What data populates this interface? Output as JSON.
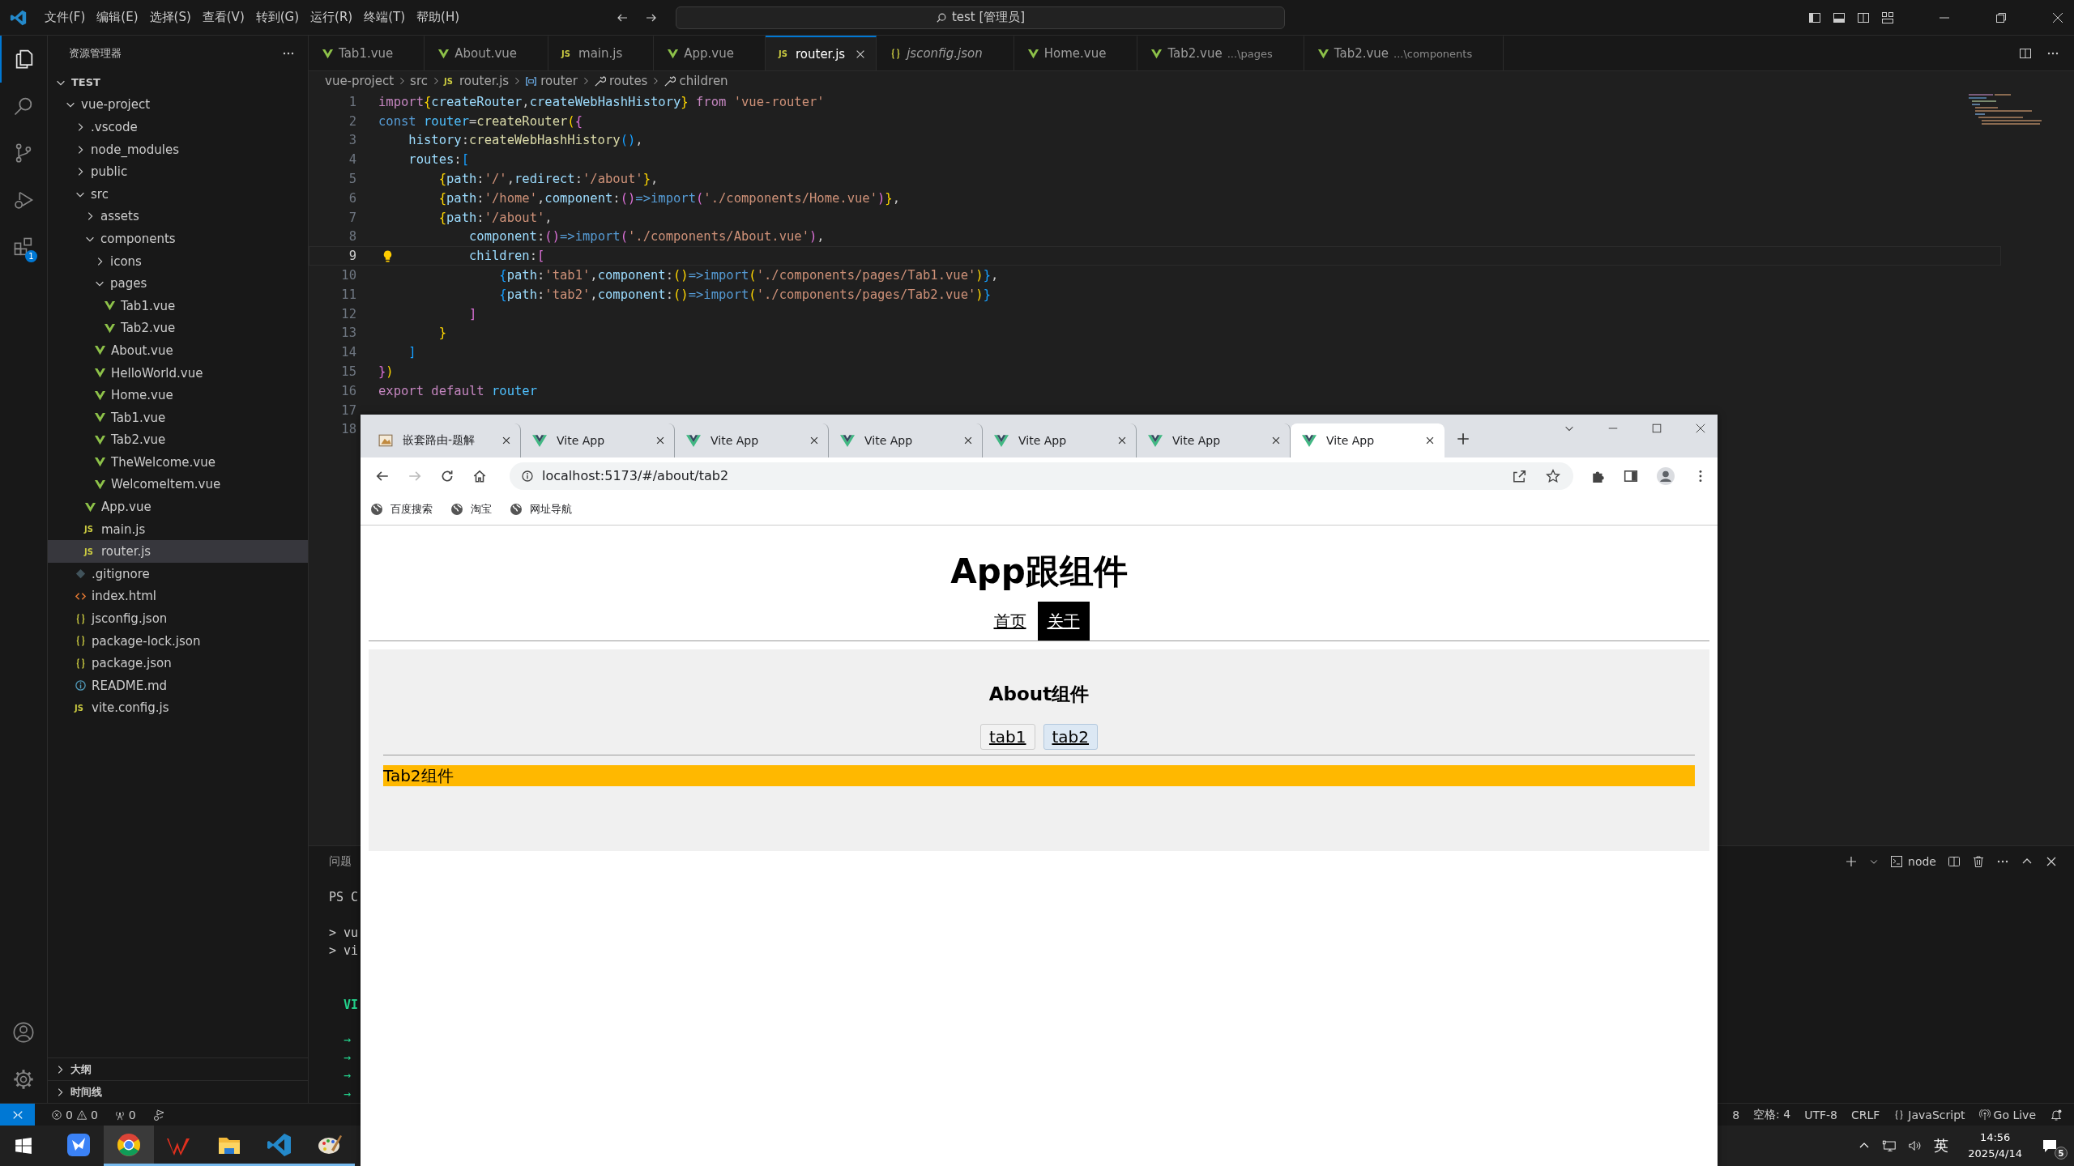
{
  "titlebar": {
    "menus": [
      "文件(F)",
      "编辑(E)",
      "选择(S)",
      "查看(V)",
      "转到(G)",
      "运行(R)",
      "终端(T)",
      "帮助(H)"
    ],
    "search": "test [管理员]"
  },
  "activity_bar": {
    "extensions_badge": "1"
  },
  "explorer": {
    "title": "资源管理器",
    "tree": [
      {
        "label": "TEST",
        "kind": "root",
        "expanded": true,
        "selected": false,
        "children": [
          {
            "label": "vue-project",
            "kind": "folder",
            "expanded": true,
            "selected": false,
            "children": [
              {
                "label": ".vscode",
                "kind": "folder",
                "expanded": false,
                "selected": false
              },
              {
                "label": "node_modules",
                "kind": "folder",
                "expanded": false,
                "selected": false
              },
              {
                "label": "public",
                "kind": "folder",
                "expanded": false,
                "selected": false
              },
              {
                "label": "src",
                "kind": "folder",
                "expanded": true,
                "selected": false,
                "children": [
                  {
                    "label": "assets",
                    "kind": "folder",
                    "expanded": false,
                    "selected": false
                  },
                  {
                    "label": "components",
                    "kind": "folder",
                    "expanded": true,
                    "selected": false,
                    "children": [
                      {
                        "label": "icons",
                        "kind": "folder",
                        "expanded": false,
                        "selected": false
                      },
                      {
                        "label": "pages",
                        "kind": "folder",
                        "expanded": true,
                        "selected": false,
                        "children": [
                          {
                            "label": "Tab1.vue",
                            "kind": "vue",
                            "selected": false
                          },
                          {
                            "label": "Tab2.vue",
                            "kind": "vue",
                            "selected": false
                          }
                        ]
                      },
                      {
                        "label": "About.vue",
                        "kind": "vue",
                        "selected": false
                      },
                      {
                        "label": "HelloWorld.vue",
                        "kind": "vue",
                        "selected": false
                      },
                      {
                        "label": "Home.vue",
                        "kind": "vue",
                        "selected": false
                      },
                      {
                        "label": "Tab1.vue",
                        "kind": "vue",
                        "selected": false
                      },
                      {
                        "label": "Tab2.vue",
                        "kind": "vue",
                        "selected": false
                      },
                      {
                        "label": "TheWelcome.vue",
                        "kind": "vue",
                        "selected": false
                      },
                      {
                        "label": "WelcomeItem.vue",
                        "kind": "vue",
                        "selected": false
                      }
                    ]
                  },
                  {
                    "label": "App.vue",
                    "kind": "vue",
                    "selected": false
                  },
                  {
                    "label": "main.js",
                    "kind": "js",
                    "badge": "JS",
                    "selected": false
                  },
                  {
                    "label": "router.js",
                    "kind": "js",
                    "badge": "JS",
                    "selected": true
                  }
                ]
              },
              {
                "label": ".gitignore",
                "kind": "git",
                "selected": false
              },
              {
                "label": "index.html",
                "kind": "html",
                "selected": false
              },
              {
                "label": "jsconfig.json",
                "kind": "json",
                "selected": false
              },
              {
                "label": "package-lock.json",
                "kind": "json",
                "selected": false
              },
              {
                "label": "package.json",
                "kind": "json",
                "selected": false
              },
              {
                "label": "README.md",
                "kind": "info",
                "selected": false
              },
              {
                "label": "vite.config.js",
                "kind": "js",
                "badge": "JS",
                "selected": false
              }
            ]
          }
        ]
      }
    ],
    "sections": [
      {
        "label": "大纲",
        "expanded": false
      },
      {
        "label": "时间线",
        "expanded": false
      }
    ]
  },
  "editor_tabs": [
    {
      "label": "Tab1.vue",
      "kind": "vue",
      "selected": false,
      "preview": false
    },
    {
      "label": "About.vue",
      "kind": "vue",
      "selected": false,
      "preview": false
    },
    {
      "label": "main.js",
      "kind": "js",
      "badge": "JS",
      "selected": false,
      "preview": false
    },
    {
      "label": "App.vue",
      "kind": "vue",
      "selected": false,
      "preview": false
    },
    {
      "label": "router.js",
      "kind": "js",
      "badge": "JS",
      "selected": true,
      "preview": false
    },
    {
      "label": "jsconfig.json",
      "kind": "json",
      "selected": false,
      "preview": true
    },
    {
      "label": "Home.vue",
      "kind": "vue",
      "selected": false,
      "preview": false
    },
    {
      "label": "Tab2.vue",
      "kind": "vue",
      "detail": "...\\pages",
      "selected": false,
      "preview": false
    },
    {
      "label": "Tab2.vue",
      "kind": "vue",
      "detail": "...\\components",
      "selected": false,
      "preview": false
    }
  ],
  "breadcrumb": [
    {
      "label": "vue-project",
      "kind": "plain"
    },
    {
      "label": "src",
      "kind": "plain"
    },
    {
      "label": "router.js",
      "kind": "js",
      "badge": "JS"
    },
    {
      "label": "router",
      "kind": "variable"
    },
    {
      "label": "routes",
      "kind": "property"
    },
    {
      "label": "children",
      "kind": "property"
    }
  ],
  "code": {
    "lines": [
      {
        "number": "1",
        "current": false,
        "tokens": [
          {
            "text": "import",
            "kind": "k"
          },
          {
            "text": "{",
            "kind": "b1"
          },
          {
            "text": "createRouter",
            "kind": "v"
          },
          {
            "text": ",",
            "kind": "p"
          },
          {
            "text": "createWebHashHistory",
            "kind": "v"
          },
          {
            "text": "}",
            "kind": "b1"
          },
          {
            "text": " from ",
            "kind": "k"
          },
          {
            "text": "'vue-router'",
            "kind": "s"
          }
        ]
      },
      {
        "number": "2",
        "current": false,
        "tokens": [
          {
            "text": "const",
            "kind": "d"
          },
          {
            "text": " router",
            "kind": "c"
          },
          {
            "text": "=",
            "kind": "p"
          },
          {
            "text": "createRouter",
            "kind": "f"
          },
          {
            "text": "(",
            "kind": "b1"
          },
          {
            "text": "{",
            "kind": "b2"
          }
        ]
      },
      {
        "number": "3",
        "current": false,
        "tokens": [
          {
            "text": "    history",
            "kind": "v"
          },
          {
            "text": ":",
            "kind": "p"
          },
          {
            "text": "createWebHashHistory",
            "kind": "f"
          },
          {
            "text": "()",
            "kind": "b3"
          },
          {
            "text": ",",
            "kind": "p"
          }
        ]
      },
      {
        "number": "4",
        "current": false,
        "tokens": [
          {
            "text": "    routes",
            "kind": "v"
          },
          {
            "text": ":",
            "kind": "p"
          },
          {
            "text": "[",
            "kind": "b3"
          }
        ]
      },
      {
        "number": "5",
        "current": false,
        "tokens": [
          {
            "text": "        {",
            "kind": "b1"
          },
          {
            "text": "path",
            "kind": "v"
          },
          {
            "text": ":",
            "kind": "p"
          },
          {
            "text": "'/'",
            "kind": "s"
          },
          {
            "text": ",",
            "kind": "p"
          },
          {
            "text": "redirect",
            "kind": "v"
          },
          {
            "text": ":",
            "kind": "p"
          },
          {
            "text": "'/about'",
            "kind": "s"
          },
          {
            "text": "}",
            "kind": "b1"
          },
          {
            "text": ",",
            "kind": "p"
          }
        ]
      },
      {
        "number": "6",
        "current": false,
        "tokens": [
          {
            "text": "        {",
            "kind": "b1"
          },
          {
            "text": "path",
            "kind": "v"
          },
          {
            "text": ":",
            "kind": "p"
          },
          {
            "text": "'/home'",
            "kind": "s"
          },
          {
            "text": ",",
            "kind": "p"
          },
          {
            "text": "component",
            "kind": "v"
          },
          {
            "text": ":",
            "kind": "p"
          },
          {
            "text": "()",
            "kind": "b2"
          },
          {
            "text": "=>",
            "kind": "d"
          },
          {
            "text": "import",
            "kind": "d"
          },
          {
            "text": "(",
            "kind": "b2"
          },
          {
            "text": "'./components/Home.vue'",
            "kind": "s"
          },
          {
            "text": ")",
            "kind": "b2"
          },
          {
            "text": "}",
            "kind": "b1"
          },
          {
            "text": ",",
            "kind": "p"
          }
        ]
      },
      {
        "number": "7",
        "current": false,
        "tokens": [
          {
            "text": "        {",
            "kind": "b1"
          },
          {
            "text": "path",
            "kind": "v"
          },
          {
            "text": ":",
            "kind": "p"
          },
          {
            "text": "'/about'",
            "kind": "s"
          },
          {
            "text": ",",
            "kind": "p"
          }
        ]
      },
      {
        "number": "8",
        "current": false,
        "tokens": [
          {
            "text": "            component",
            "kind": "v"
          },
          {
            "text": ":",
            "kind": "p"
          },
          {
            "text": "()",
            "kind": "b2"
          },
          {
            "text": "=>",
            "kind": "d"
          },
          {
            "text": "import",
            "kind": "d"
          },
          {
            "text": "(",
            "kind": "b2"
          },
          {
            "text": "'./components/About.vue'",
            "kind": "s"
          },
          {
            "text": ")",
            "kind": "b2"
          },
          {
            "text": ",",
            "kind": "p"
          }
        ]
      },
      {
        "number": "9",
        "current": true,
        "tokens": [
          {
            "text": "            children",
            "kind": "v"
          },
          {
            "text": ":",
            "kind": "p"
          },
          {
            "text": "[",
            "kind": "b2"
          }
        ]
      },
      {
        "number": "10",
        "current": false,
        "tokens": [
          {
            "text": "                {",
            "kind": "b3"
          },
          {
            "text": "path",
            "kind": "v"
          },
          {
            "text": ":",
            "kind": "p"
          },
          {
            "text": "'tab1'",
            "kind": "s"
          },
          {
            "text": ",",
            "kind": "p"
          },
          {
            "text": "component",
            "kind": "v"
          },
          {
            "text": ":",
            "kind": "p"
          },
          {
            "text": "()",
            "kind": "b1"
          },
          {
            "text": "=>",
            "kind": "d"
          },
          {
            "text": "import",
            "kind": "d"
          },
          {
            "text": "(",
            "kind": "b1"
          },
          {
            "text": "'./components/pages/Tab1.vue'",
            "kind": "s"
          },
          {
            "text": ")",
            "kind": "b1"
          },
          {
            "text": "}",
            "kind": "b3"
          },
          {
            "text": ",",
            "kind": "p"
          }
        ]
      },
      {
        "number": "11",
        "current": false,
        "tokens": [
          {
            "text": "                {",
            "kind": "b3"
          },
          {
            "text": "path",
            "kind": "v"
          },
          {
            "text": ":",
            "kind": "p"
          },
          {
            "text": "'tab2'",
            "kind": "s"
          },
          {
            "text": ",",
            "kind": "p"
          },
          {
            "text": "component",
            "kind": "v"
          },
          {
            "text": ":",
            "kind": "p"
          },
          {
            "text": "()",
            "kind": "b1"
          },
          {
            "text": "=>",
            "kind": "d"
          },
          {
            "text": "import",
            "kind": "d"
          },
          {
            "text": "(",
            "kind": "b1"
          },
          {
            "text": "'./components/pages/Tab2.vue'",
            "kind": "s"
          },
          {
            "text": ")",
            "kind": "b1"
          },
          {
            "text": "}",
            "kind": "b3"
          }
        ]
      },
      {
        "number": "12",
        "current": false,
        "tokens": [
          {
            "text": "            ]",
            "kind": "b2"
          }
        ]
      },
      {
        "number": "13",
        "current": false,
        "tokens": [
          {
            "text": "        }",
            "kind": "b1"
          }
        ]
      },
      {
        "number": "14",
        "current": false,
        "tokens": [
          {
            "text": "    ]",
            "kind": "b3"
          }
        ]
      },
      {
        "number": "15",
        "current": false,
        "tokens": [
          {
            "text": "}",
            "kind": "b2"
          },
          {
            "text": ")",
            "kind": "b1"
          }
        ]
      },
      {
        "number": "16",
        "current": false,
        "tokens": [
          {
            "text": "export default ",
            "kind": "k"
          },
          {
            "text": "router",
            "kind": "c"
          }
        ]
      },
      {
        "number": "17",
        "current": false
      },
      {
        "number": "18",
        "current": false
      }
    ]
  },
  "panel": {
    "tab": "问题",
    "shell": "node",
    "lines": [
      {
        "text": "PS C",
        "kind": "prompt"
      },
      {
        "text": "> vu",
        "kind": "plain"
      },
      {
        "text": "> vi",
        "kind": "plain"
      },
      {
        "text": "VI",
        "kind": "title"
      },
      {
        "text": "→",
        "kind": "arrow"
      },
      {
        "text": "→",
        "kind": "arrow"
      },
      {
        "text": "→",
        "kind": "arrow"
      },
      {
        "text": "→",
        "kind": "arrow"
      }
    ]
  },
  "status_bar": {
    "errors": "0",
    "warnings": "0",
    "ports": "0",
    "right": [
      {
        "text": "8",
        "kind": "plain"
      },
      {
        "text": "空格: 4",
        "kind": "plain"
      },
      {
        "text": "UTF-8",
        "kind": "plain"
      },
      {
        "text": "CRLF",
        "kind": "plain"
      },
      {
        "text": "JavaScript",
        "kind": "language"
      },
      {
        "text": "Go Live",
        "kind": "live"
      }
    ]
  },
  "taskbar": {
    "apps": [
      {
        "kind": "bird",
        "selected": false,
        "running": false
      },
      {
        "kind": "browser",
        "selected": true,
        "running": true
      },
      {
        "kind": "office",
        "selected": false,
        "running": true
      },
      {
        "kind": "folder",
        "selected": false,
        "running": true
      },
      {
        "kind": "editor",
        "selected": false,
        "running": true
      },
      {
        "kind": "paint",
        "selected": false,
        "running": true
      }
    ],
    "ime": "英",
    "time": "14:56",
    "date": "2025/4/14",
    "notifications": "5"
  },
  "browser": {
    "tabs": [
      {
        "label": "嵌套路由-题解",
        "kind": "doc",
        "selected": false
      },
      {
        "label": "Vite App",
        "kind": "vite",
        "selected": false
      },
      {
        "label": "Vite App",
        "kind": "vite",
        "selected": false
      },
      {
        "label": "Vite App",
        "kind": "vite",
        "selected": false
      },
      {
        "label": "Vite App",
        "kind": "vite",
        "selected": false
      },
      {
        "label": "Vite App",
        "kind": "vite",
        "selected": false
      },
      {
        "label": "Vite App",
        "kind": "vite",
        "selected": true
      }
    ],
    "url": "localhost:5173/#/about/tab2",
    "bookmarks": [
      "百度搜索",
      "淘宝",
      "网址导航"
    ],
    "page": {
      "heading": "App跟组件",
      "nav": [
        {
          "label": "首页",
          "selected": false
        },
        {
          "label": "关于",
          "selected": true
        }
      ],
      "panel": {
        "heading": "About组件",
        "tabs": [
          {
            "label": "tab1",
            "selected": false
          },
          {
            "label": "tab2",
            "selected": true
          }
        ],
        "content": "Tab2组件"
      }
    }
  }
}
